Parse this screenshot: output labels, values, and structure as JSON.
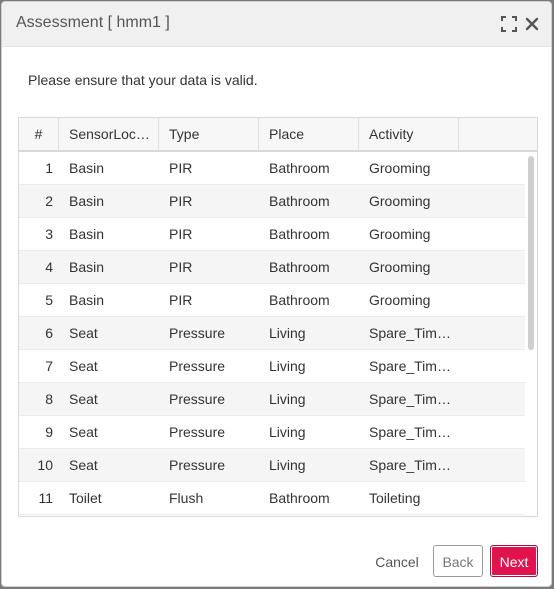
{
  "dialog": {
    "title": "Assessment [ hmm1 ]",
    "message": "Please ensure that your data is valid."
  },
  "table": {
    "columns": [
      "#",
      "SensorLoc…",
      "Type",
      "Place",
      "Activity"
    ],
    "rows": [
      [
        "1",
        "Basin",
        "PIR",
        "Bathroom",
        "Grooming"
      ],
      [
        "2",
        "Basin",
        "PIR",
        "Bathroom",
        "Grooming"
      ],
      [
        "3",
        "Basin",
        "PIR",
        "Bathroom",
        "Grooming"
      ],
      [
        "4",
        "Basin",
        "PIR",
        "Bathroom",
        "Grooming"
      ],
      [
        "5",
        "Basin",
        "PIR",
        "Bathroom",
        "Grooming"
      ],
      [
        "6",
        "Seat",
        "Pressure",
        "Living",
        "Spare_Tim…"
      ],
      [
        "7",
        "Seat",
        "Pressure",
        "Living",
        "Spare_Tim…"
      ],
      [
        "8",
        "Seat",
        "Pressure",
        "Living",
        "Spare_Tim…"
      ],
      [
        "9",
        "Seat",
        "Pressure",
        "Living",
        "Spare_Tim…"
      ],
      [
        "10",
        "Seat",
        "Pressure",
        "Living",
        "Spare_Tim…"
      ],
      [
        "11",
        "Toilet",
        "Flush",
        "Bathroom",
        "Toileting"
      ]
    ]
  },
  "buttons": {
    "cancel": "Cancel",
    "back": "Back",
    "next": "Next"
  },
  "icons": {
    "expand": "expand-icon",
    "close": "close-icon"
  },
  "colors": {
    "accent": "#e0134f",
    "titlebar": "#f0f0f0",
    "row_alt": "#f5f5f5"
  }
}
